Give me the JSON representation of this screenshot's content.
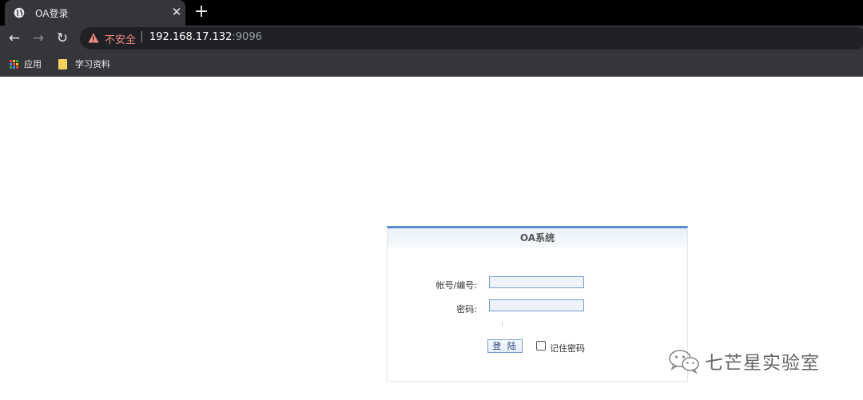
{
  "browser": {
    "tab_title": "OA登录",
    "tab_close": "✕",
    "new_tab": "+",
    "back": "←",
    "forward": "→",
    "reload": "↻",
    "insecure_label": "不安全",
    "separator": "|",
    "url_host": "192.168.17.132",
    "url_port": ":9096"
  },
  "bookmarks": {
    "apps_label": "应用",
    "folder_label": "学习资料"
  },
  "login": {
    "title": "OA系统",
    "account_label": "帐号/编号:",
    "account_value": "",
    "password_label": "密码:",
    "password_value": "",
    "submit_label": "登 陆",
    "remember_label": "记住密码"
  },
  "watermark": {
    "text": "七芒星实验室"
  },
  "colors": {
    "accent": "#5b8bd1",
    "insecure": "#f28b82"
  }
}
